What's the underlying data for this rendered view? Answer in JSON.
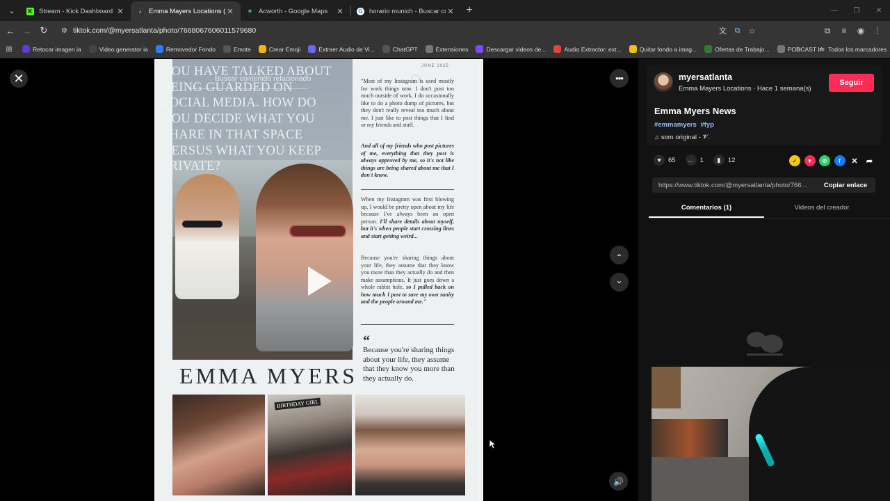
{
  "browser": {
    "tabs": [
      {
        "title": "Stream - Kick Dashboard",
        "icon": "kick-icon",
        "color": "#53fc18",
        "active": false
      },
      {
        "title": "Emma Mayers Locations (@my",
        "icon": "tiktok-icon",
        "color": "#ffffff",
        "active": true
      },
      {
        "title": "Acworth - Google Maps",
        "icon": "maps-pin-icon",
        "color": "#34a853",
        "active": false
      },
      {
        "title": "horario munich - Buscar con Go",
        "icon": "google-icon",
        "color": "#4285f4",
        "active": false
      }
    ],
    "url": "tiktok.com/@myersatlanta/photo/7668067606011579680",
    "bookmarks": [
      {
        "label": "Retocar imagen ia",
        "color": "#5c3bd6"
      },
      {
        "label": "Video generator ia",
        "color": "#444444"
      },
      {
        "label": "Removedor Fondo",
        "color": "#2f7bf6"
      },
      {
        "label": "Emote",
        "color": "#555555"
      },
      {
        "label": "Crear Emoji",
        "color": "#f4b400"
      },
      {
        "label": "Extraer Audio de Vi...",
        "color": "#6a6af0"
      },
      {
        "label": "ChatGPT",
        "color": "#555555"
      },
      {
        "label": "Extensiones",
        "color": "#777777"
      },
      {
        "label": "Descargar videos de...",
        "color": "#7c4dff"
      },
      {
        "label": "Audio Extractor: ext...",
        "color": "#ea4335"
      },
      {
        "label": "Quitar fondo a imag...",
        "color": "#f4c20d"
      },
      {
        "label": "Ofertas de Trabajo...",
        "color": "#2e7d32"
      },
      {
        "label": "PODCAST IA",
        "color": "#777777"
      }
    ],
    "bookmarks_more": "»",
    "all_bookmarks": "Todos los marcadores"
  },
  "photo": {
    "headline": "YOU HAVE TALKED ABOUT BEING GUARDED ON SOCIAL MEDIA. HOW DO YOU DECIDE WHAT YOU SHARE IN THAT SPACE VERSUS WHAT YOU KEEP PRIVATE?",
    "search_overlay": "Buscar contenido relacionado",
    "date": "JUNE 2025",
    "para1": "\"Most of my Instagram is used mostly for work things now. I don't post too much outside of work. I do occasionally like to do a photo dump of pictures, but they don't really reveal too much about me. I just like to post things that I find or my friends and stuff.",
    "para2": "And all of my friends who post pictures of me, everything that they post is always approved by me, so it's not like things are being shared about me that I don't know.",
    "para3": "When my Instagram was first blowing up, I would be pretty open about my life because I've always been an open person.",
    "para3b": "I'll share details about myself, but it's when people start crossing lines and start getting weird...",
    "para4": "Because you're sharing things about your life, they assume that they know you more than they actually do and then make assumptions. It just goes down a whole rabbit hole,",
    "para4b": "so I pulled back on how much I post to save my own sanity and the people around me.\"",
    "quote_mark": "“",
    "pull_quote": "Because you're sharing things about your life, they assume that they know you more than they actually do.",
    "name": "EMMA MYERS",
    "bday": "BIRTHDAY GIRL"
  },
  "post": {
    "username": "myersatlanta",
    "subline": "Emma Mayers Locations · Hace 1 semana(s)",
    "follow": "Seguir",
    "title": "Emma Myers News",
    "tags": [
      "#emmamyers",
      "#fyp"
    ],
    "sound": "♫  som original - 𝓥.",
    "likes": "65",
    "comments": "1",
    "saves": "12",
    "link": "https://www.tiktok.com/@myersatlanta/photo/766...",
    "copy": "Copiar enlace",
    "tab_comments": "Comentarios (1)",
    "tab_videos": "Videos del creador"
  },
  "icons": {
    "close": "✕",
    "more": "•••",
    "up": "⌃",
    "down": "⌄",
    "volume": "🔊"
  }
}
